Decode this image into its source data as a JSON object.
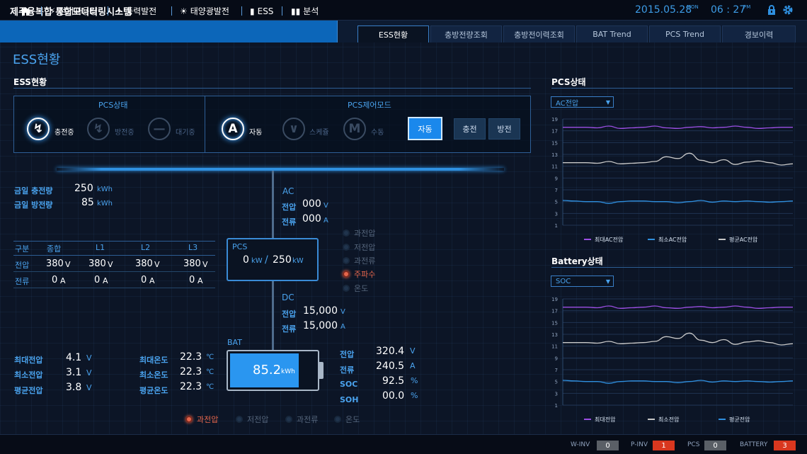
{
  "header": {
    "title": "제주융복합 통합모니터링시스템",
    "date": "2015.05.28",
    "date_suffix": "MON",
    "time": "06 : 27",
    "time_suffix": "PM"
  },
  "nav": {
    "items": [
      "전기사용량",
      "풍력발전",
      "태양광발전",
      "ESS",
      "분석"
    ]
  },
  "tabs": [
    "ESS현황",
    "충방전량조회",
    "충방전이력조회",
    "BAT Trend",
    "PCS Trend",
    "경보이력"
  ],
  "page_title": "ESS현황",
  "ess": {
    "section_title": "ESS현황",
    "pcs_state_title": "PCS상태",
    "pcs_states": [
      "충전중",
      "방전중",
      "대기중"
    ],
    "control_title": "PCS제어모드",
    "control_modes": [
      "자동",
      "스케쥴",
      "수동"
    ],
    "buttons": {
      "auto": "자동",
      "charge": "충전",
      "discharge": "방전"
    },
    "today": {
      "charge_label": "금일 충전량",
      "charge_value": "250",
      "discharge_label": "금일 방전량",
      "discharge_value": "85",
      "unit": "kWh"
    },
    "ac": {
      "title": "AC",
      "voltage_label": "전압",
      "voltage": "000",
      "voltage_unit": "V",
      "current_label": "전류",
      "current": "000",
      "current_unit": "A"
    },
    "pcs_alarms": [
      "과전압",
      "저전압",
      "과전류",
      "주파수",
      "온도"
    ],
    "pcs_box": {
      "title": "PCS",
      "value": "0",
      "unit": "kW",
      "sep": "/",
      "rated": "250",
      "rated_unit": "kW"
    },
    "dc": {
      "title": "DC",
      "voltage_label": "전압",
      "voltage": "15,000",
      "voltage_unit": "V",
      "current_label": "전류",
      "current": "15,000",
      "current_unit": "A"
    },
    "table": {
      "headers": [
        "구분",
        "종합",
        "L1",
        "L2",
        "L3"
      ],
      "rows": [
        {
          "label": "전압",
          "values": [
            "380",
            "380",
            "380",
            "380"
          ],
          "unit": "V"
        },
        {
          "label": "전류",
          "values": [
            "0",
            "0",
            "0",
            "0"
          ],
          "unit": "A"
        }
      ]
    },
    "bat": {
      "title": "BAT",
      "level": "85.2",
      "unit": "kWh",
      "fill_fraction": 0.79,
      "stats": [
        {
          "label": "전압",
          "value": "320.4",
          "unit": "V"
        },
        {
          "label": "전류",
          "value": "240.5",
          "unit": "A"
        },
        {
          "label": "SOC",
          "value": "92.5",
          "unit": "%"
        },
        {
          "label": "SOH",
          "value": "00.0",
          "unit": "%"
        }
      ]
    },
    "cell_voltage": [
      {
        "label": "최대전압",
        "value": "4.1",
        "unit": "V"
      },
      {
        "label": "최소전압",
        "value": "3.1",
        "unit": "V"
      },
      {
        "label": "평균전압",
        "value": "3.8",
        "unit": "V"
      }
    ],
    "cell_temp": [
      {
        "label": "최대온도",
        "value": "22.3",
        "unit": "℃"
      },
      {
        "label": "최소온도",
        "value": "22.3",
        "unit": "℃"
      },
      {
        "label": "평균온도",
        "value": "22.3",
        "unit": "℃"
      }
    ],
    "bat_alarms": [
      "과전압",
      "저전압",
      "과전류",
      "온도"
    ]
  },
  "pcs_chart": {
    "title": "PCS상태",
    "select": "AC전압"
  },
  "bat_chart": {
    "title": "Battery상태",
    "select": "SOC"
  },
  "chart_data": [
    {
      "type": "line",
      "yticks": [
        1,
        3,
        5,
        7,
        9,
        11,
        13,
        15,
        17,
        19
      ],
      "ylim": [
        1,
        19
      ],
      "x": [
        0,
        1,
        2,
        3,
        4,
        5,
        6,
        7,
        8,
        9,
        10,
        11,
        12,
        13,
        14,
        15,
        16,
        17,
        18,
        19,
        20
      ],
      "series": [
        {
          "name": "최대AC전압",
          "color": "#9c4fe4",
          "values": [
            17.6,
            17.6,
            17.6,
            17.5,
            17.8,
            17.4,
            17.5,
            17.6,
            17.8,
            17.5,
            17.4,
            17.6,
            17.7,
            17.5,
            17.6,
            17.8,
            17.6,
            17.4,
            17.5,
            17.6,
            17.6
          ]
        },
        {
          "name": "평균AC전압",
          "color": "#c8c8c8",
          "values": [
            11.6,
            11.6,
            11.6,
            11.5,
            11.8,
            11.4,
            11.5,
            11.6,
            11.8,
            12.6,
            12.3,
            13.2,
            12.0,
            11.6,
            12.1,
            11.3,
            11.7,
            11.9,
            11.6,
            11.2,
            11.4
          ]
        },
        {
          "name": "최소AC전압",
          "color": "#2f90e0",
          "values": [
            5.2,
            5.1,
            5.0,
            5.0,
            4.7,
            5.0,
            5.1,
            5.1,
            5.0,
            5.0,
            4.8,
            5.0,
            5.2,
            4.9,
            5.1,
            5.0,
            5.1,
            5.0,
            4.9,
            5.0,
            5.1
          ]
        }
      ]
    },
    {
      "type": "line",
      "yticks": [
        1,
        3,
        5,
        7,
        9,
        11,
        13,
        15,
        17,
        19
      ],
      "ylim": [
        1,
        19
      ],
      "x": [
        0,
        1,
        2,
        3,
        4,
        5,
        6,
        7,
        8,
        9,
        10,
        11,
        12,
        13,
        14,
        15,
        16,
        17,
        18,
        19,
        20
      ],
      "series": [
        {
          "name": "최대전압",
          "color": "#9c4fe4",
          "values": [
            17.6,
            17.6,
            17.6,
            17.5,
            17.8,
            17.4,
            17.5,
            17.6,
            17.8,
            17.5,
            17.4,
            17.6,
            17.7,
            17.5,
            17.6,
            17.8,
            17.6,
            17.4,
            17.5,
            17.6,
            17.6
          ]
        },
        {
          "name": "최소전압",
          "color": "#c8c8c8",
          "values": [
            11.6,
            11.6,
            11.6,
            11.5,
            11.8,
            11.4,
            11.5,
            11.6,
            11.8,
            12.6,
            12.3,
            13.2,
            12.0,
            11.6,
            12.1,
            11.3,
            11.7,
            11.9,
            11.6,
            11.2,
            11.4
          ]
        },
        {
          "name": "평균전압",
          "color": "#2f90e0",
          "values": [
            5.2,
            5.1,
            5.0,
            5.0,
            4.7,
            5.0,
            5.1,
            5.1,
            5.0,
            5.0,
            4.8,
            5.0,
            5.2,
            4.9,
            5.1,
            5.0,
            5.1,
            5.0,
            4.9,
            5.0,
            5.1
          ]
        }
      ]
    }
  ],
  "footer": [
    {
      "label": "W-INV",
      "value": "0",
      "color": "#5a5f66"
    },
    {
      "label": "P-INV",
      "value": "1",
      "color": "#d9371f"
    },
    {
      "label": "PCS",
      "value": "0",
      "color": "#5a5f66"
    },
    {
      "label": "BATTERY",
      "value": "3",
      "color": "#d9371f"
    }
  ]
}
